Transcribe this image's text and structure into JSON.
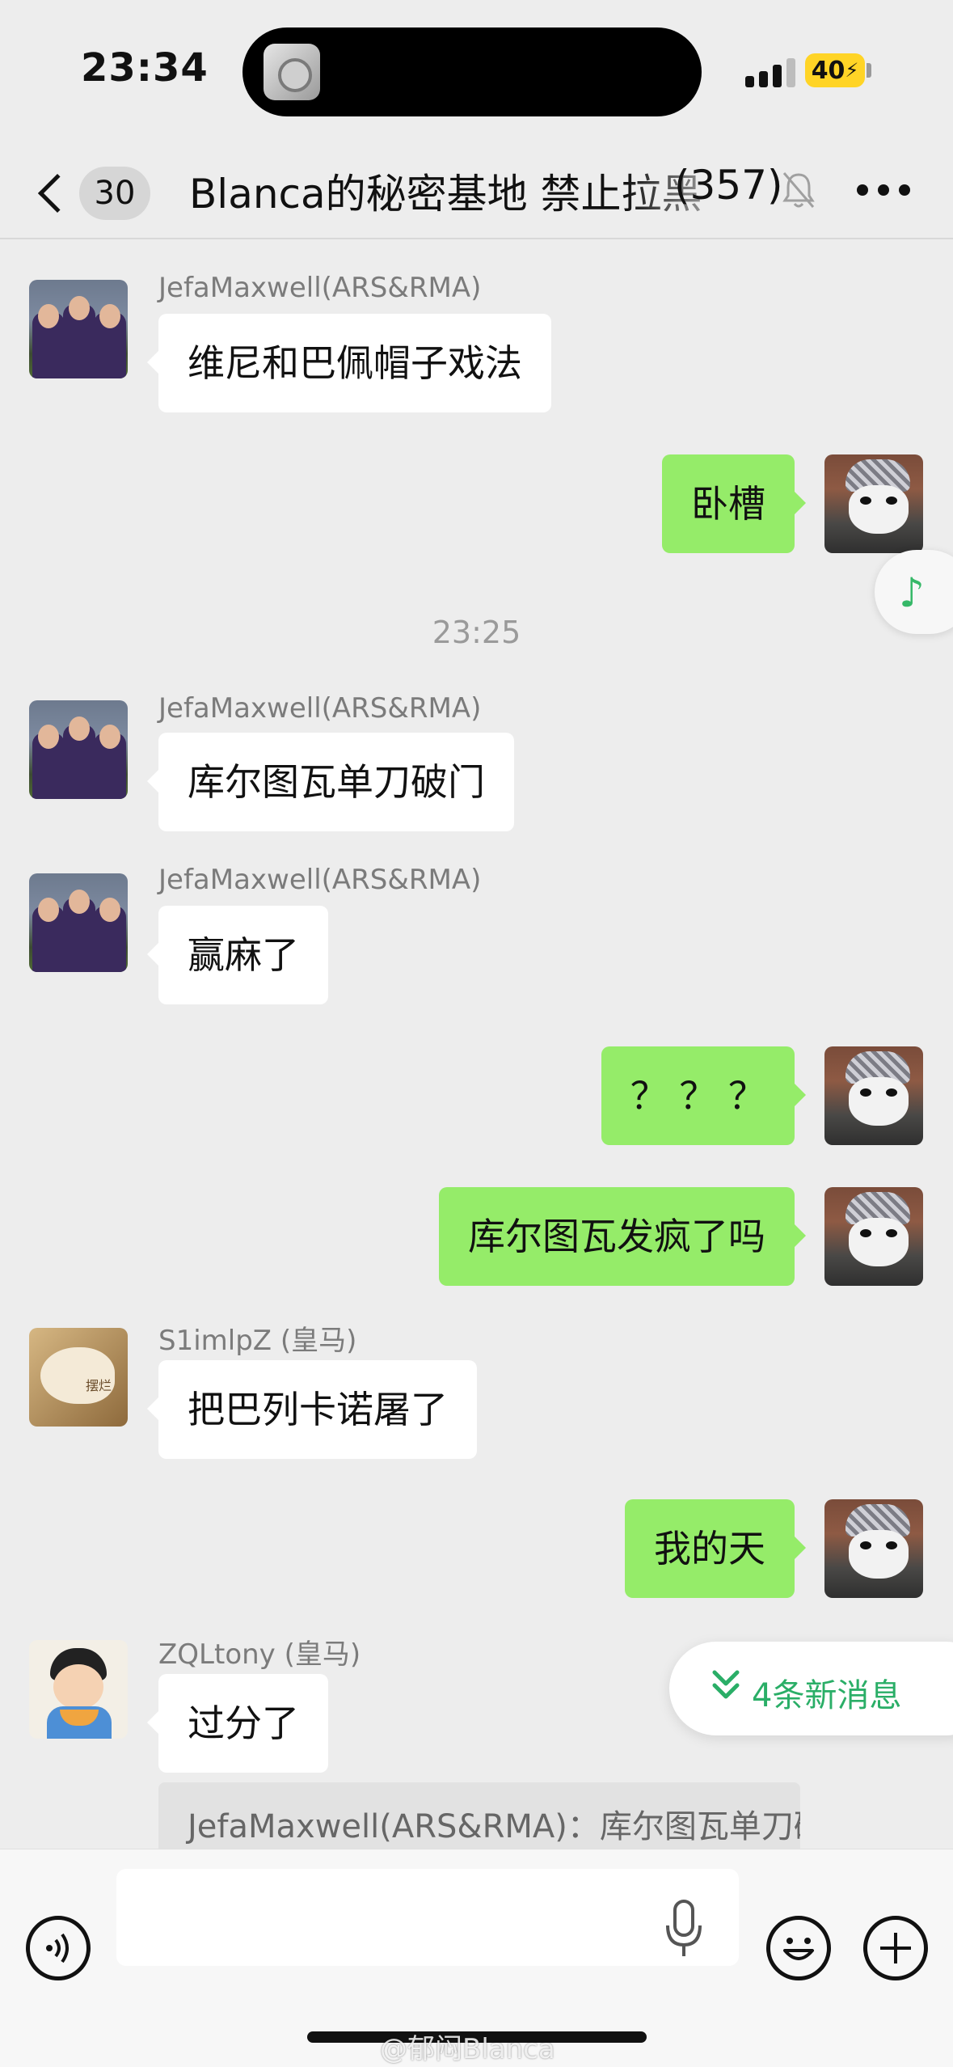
{
  "status_bar": {
    "time": "23:34",
    "battery": "40"
  },
  "nav": {
    "unread_count": "30",
    "title": "Blanca的秘密基地 禁止拉黑",
    "member_count": "(357)"
  },
  "timestamp": "23:25",
  "messages": [
    {
      "dir": "in",
      "sender": "JefaMaxwell(ARS&RMA)",
      "text": "维尼和巴佩帽子戏法",
      "avatar": "players-avatar"
    },
    {
      "dir": "out",
      "text": "卧槽",
      "avatar": "cat-avatar"
    },
    {
      "dir": "in",
      "sender": "JefaMaxwell(ARS&RMA)",
      "text": "库尔图瓦单刀破门",
      "avatar": "players-avatar"
    },
    {
      "dir": "in",
      "sender": "JefaMaxwell(ARS&RMA)",
      "text": "赢麻了",
      "avatar": "players-avatar"
    },
    {
      "dir": "out",
      "text": "？ ？ ？",
      "avatar": "cat-avatar"
    },
    {
      "dir": "out",
      "text": "库尔图瓦发疯了吗",
      "avatar": "cat-avatar"
    },
    {
      "dir": "in",
      "sender": "S1imlpZ (皇马)",
      "text": "把巴列卡诺屠了",
      "avatar": "plush-avatar",
      "avatar_tag": "摆烂"
    },
    {
      "dir": "out",
      "text": "我的天",
      "avatar": "cat-avatar"
    },
    {
      "dir": "in",
      "sender": "ZQLtony (皇马)",
      "text": "过分了",
      "avatar": "cartoon-avatar"
    }
  ],
  "quote": "JefaMaxwell(ARS&RMA)：库尔图瓦单刀破门",
  "new_messages_label": "4条新消息",
  "watermark": "@郁闷Blanca",
  "colors": {
    "outgoing_bubble": "#95ec69",
    "accent_green": "#2aae67",
    "background": "#ededed"
  }
}
